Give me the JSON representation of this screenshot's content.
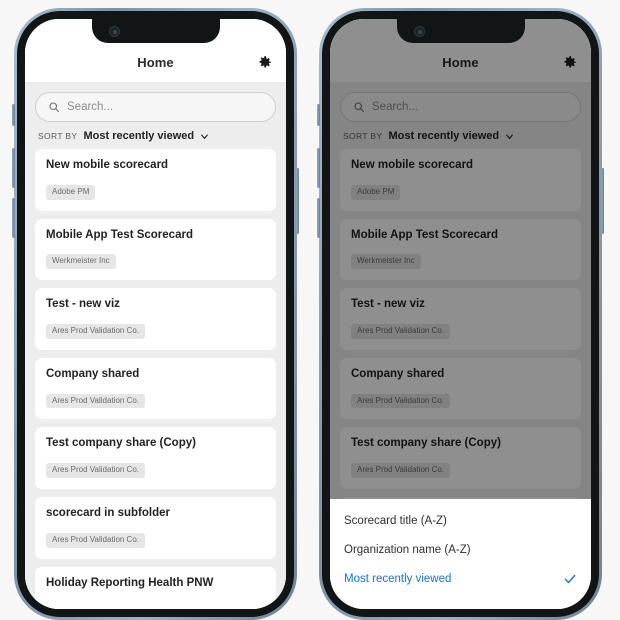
{
  "theme": {
    "accent": "#1473E6",
    "page_bg": "#f7f7f7",
    "content_bg": "#ededed",
    "card_bg": "#ffffff",
    "badge_bg": "#e6e6e6",
    "scrim": "rgba(0,0,0,0.44)"
  },
  "app": {
    "title": "Home",
    "settings_icon": "gear-icon",
    "search": {
      "icon": "search-icon",
      "value": "",
      "placeholder": "Search..."
    },
    "sort": {
      "label": "SORT BY",
      "value": "Most recently viewed",
      "chevron_icon": "chevron-down-icon"
    },
    "scorecards": [
      {
        "title": "New mobile scorecard",
        "organization": "Adobe PM"
      },
      {
        "title": "Mobile App Test Scorecard",
        "organization": "Werkmeister Inc"
      },
      {
        "title": "Test - new viz",
        "organization": "Ares Prod Validation Co."
      },
      {
        "title": "Company shared",
        "organization": "Ares Prod Validation Co."
      },
      {
        "title": "Test company share (Copy)",
        "organization": "Ares Prod Validation Co."
      },
      {
        "title": "scorecard in subfolder",
        "organization": "Ares Prod Validation Co."
      },
      {
        "title": "Holiday Reporting Health PNW",
        "organization": ""
      }
    ]
  },
  "sort_sheet": {
    "options": [
      {
        "label": "Scorecard title (A-Z)",
        "selected": false
      },
      {
        "label": "Organization name (A-Z)",
        "selected": false
      },
      {
        "label": "Most recently viewed",
        "selected": true
      }
    ],
    "check_icon": "check-icon"
  }
}
